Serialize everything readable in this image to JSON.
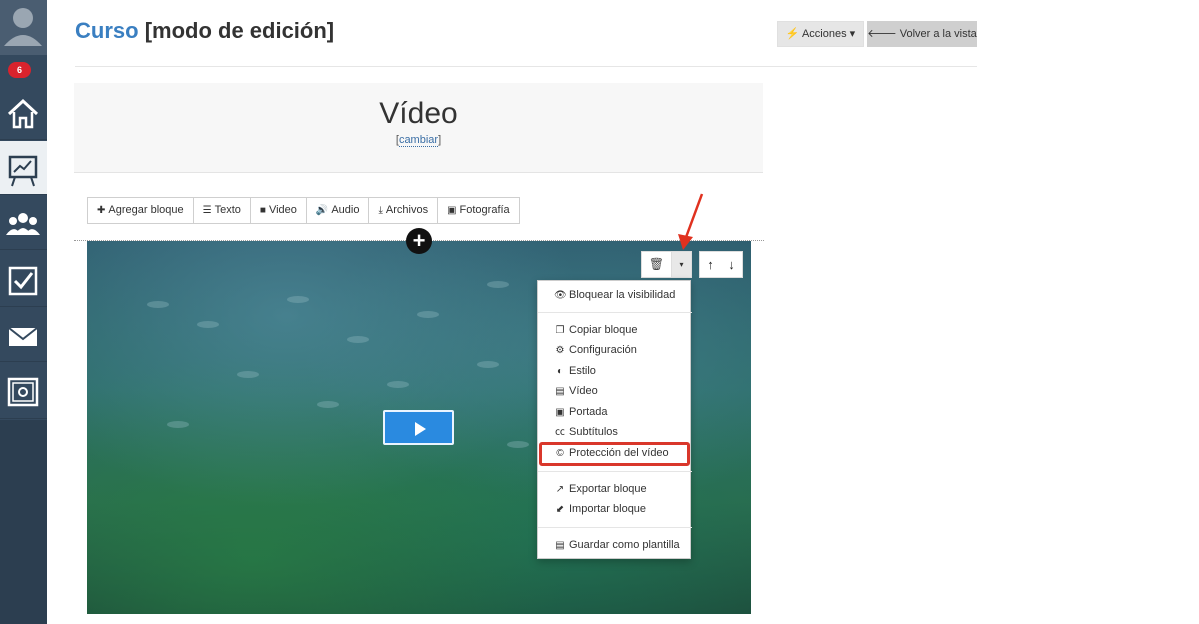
{
  "sidebar": {
    "badge": "6",
    "items": [
      "home-icon",
      "presentation-icon",
      "users-icon",
      "checkbox-icon",
      "mail-icon",
      "safe-icon"
    ]
  },
  "header": {
    "title_link": "Curso",
    "title_mode": "[modo de edición]",
    "actions_label": "⚡ Acciones ▾",
    "back_label": "🡐 Volver a la vista"
  },
  "section": {
    "title": "Vídeo",
    "change_open": "[",
    "change_label": "cambiar",
    "change_close": "]"
  },
  "toolbar": {
    "add_block": "Agregar bloque",
    "text": "Texto",
    "video": "Video",
    "audio": "Audio",
    "files": "Archivos",
    "photo": "Fotografía"
  },
  "menu": {
    "block_visibility": "Bloquear la visibilidad",
    "copy_block": "Copiar bloque",
    "configuration": "Configuración",
    "style": "Estilo",
    "video": "Vídeo",
    "cover": "Portada",
    "subtitles": "Subtítulos",
    "video_protection": "Protección del vídeo",
    "export_block": "Exportar bloque",
    "import_block": "Importar bloque",
    "save_template": "Guardar como plantilla"
  },
  "colors": {
    "sidebar": "#34495e",
    "link": "#3a7fc1",
    "play_button": "#2a8ae0",
    "highlight": "#d9372b"
  }
}
